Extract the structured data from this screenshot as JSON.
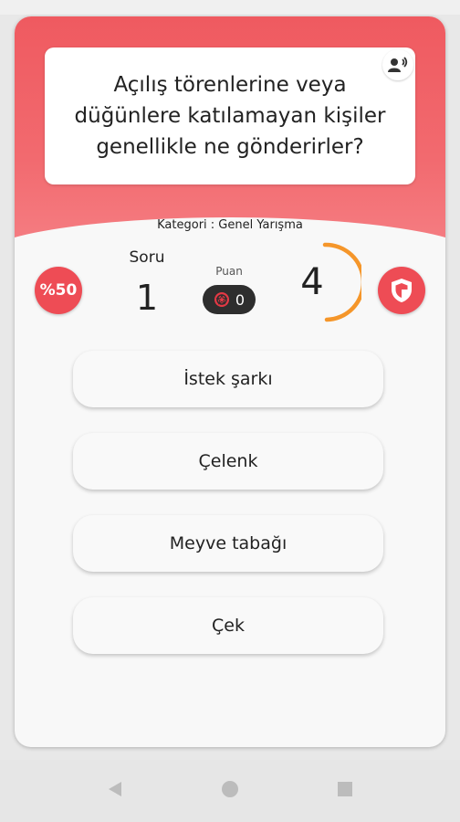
{
  "question": {
    "text": "Açılış törenlerine veya düğünlere katılamayan kişiler genellikle ne gönderirler?"
  },
  "category": {
    "text": "Kategori :  Genel Yarışma"
  },
  "jokers": {
    "fifty_label": "%50"
  },
  "stats": {
    "soru_label": "Soru",
    "soru_value": "1",
    "puan_label": "Puan",
    "puan_value": "0"
  },
  "timer": {
    "value": "4"
  },
  "answers": [
    {
      "label": "İstek şarkı"
    },
    {
      "label": "Çelenk"
    },
    {
      "label": "Meyve tabağı"
    },
    {
      "label": "Çek"
    }
  ],
  "colors": {
    "accent": "#ef5a60",
    "timer_arc": "#f5962a",
    "pill": "#2e2e2e"
  },
  "icons": {
    "speaker": "speaker-icon",
    "shield": "shield-icon",
    "coin": "coin-icon",
    "nav_back": "back-triangle-icon",
    "nav_home": "home-circle-icon",
    "nav_recent": "recent-square-icon"
  }
}
